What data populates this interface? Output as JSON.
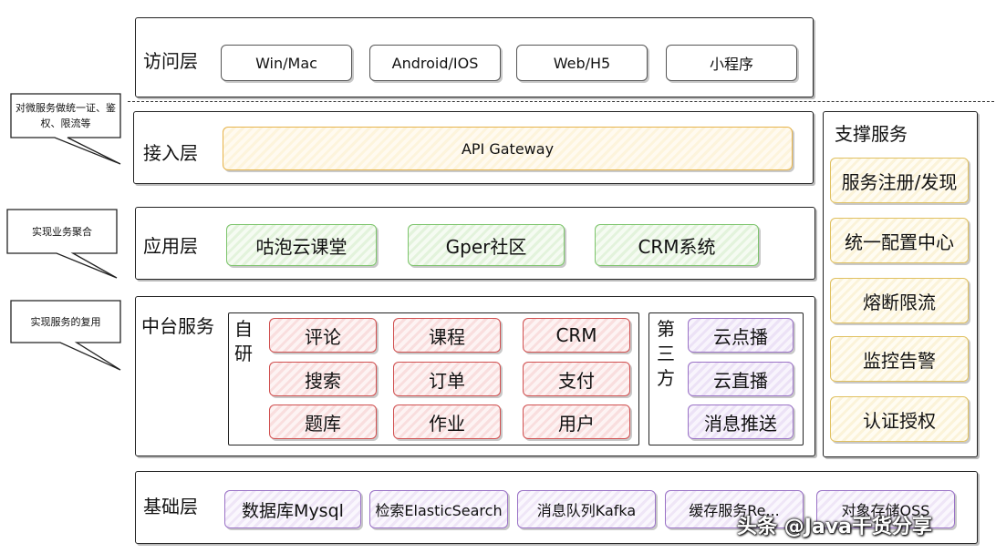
{
  "layers": {
    "access": {
      "title": "访问层",
      "items": [
        "Win/Mac",
        "Android/IOS",
        "Web/H5",
        "小程序"
      ]
    },
    "gateway": {
      "title": "接入层",
      "item": "API Gateway"
    },
    "application": {
      "title": "应用层",
      "items": [
        "咕泡云课堂",
        "Gper社区",
        "CRM系统"
      ]
    },
    "middle": {
      "title": "中台服务",
      "self_label": "自研",
      "self_items": [
        "评论",
        "课程",
        "CRM",
        "搜索",
        "订单",
        "支付",
        "题库",
        "作业",
        "用户"
      ],
      "third_label": "第三方",
      "third_items": [
        "云点播",
        "云直播",
        "消息推送"
      ]
    },
    "base": {
      "title": "基础层",
      "items": [
        "数据库Mysql",
        "检索ElasticSearch",
        "消息队列Kafka",
        "缓存服务Re...",
        "对象存储OSS"
      ]
    }
  },
  "support": {
    "title": "支撑服务",
    "items": [
      "服务注册/发现",
      "统一配置中心",
      "熔断限流",
      "监控告警",
      "认证授权"
    ]
  },
  "callouts": [
    "对微服务做统一证、鉴权、限流等",
    "实现业务聚合",
    "实现服务的复用"
  ],
  "watermark": "头条 @Java干货分享"
}
